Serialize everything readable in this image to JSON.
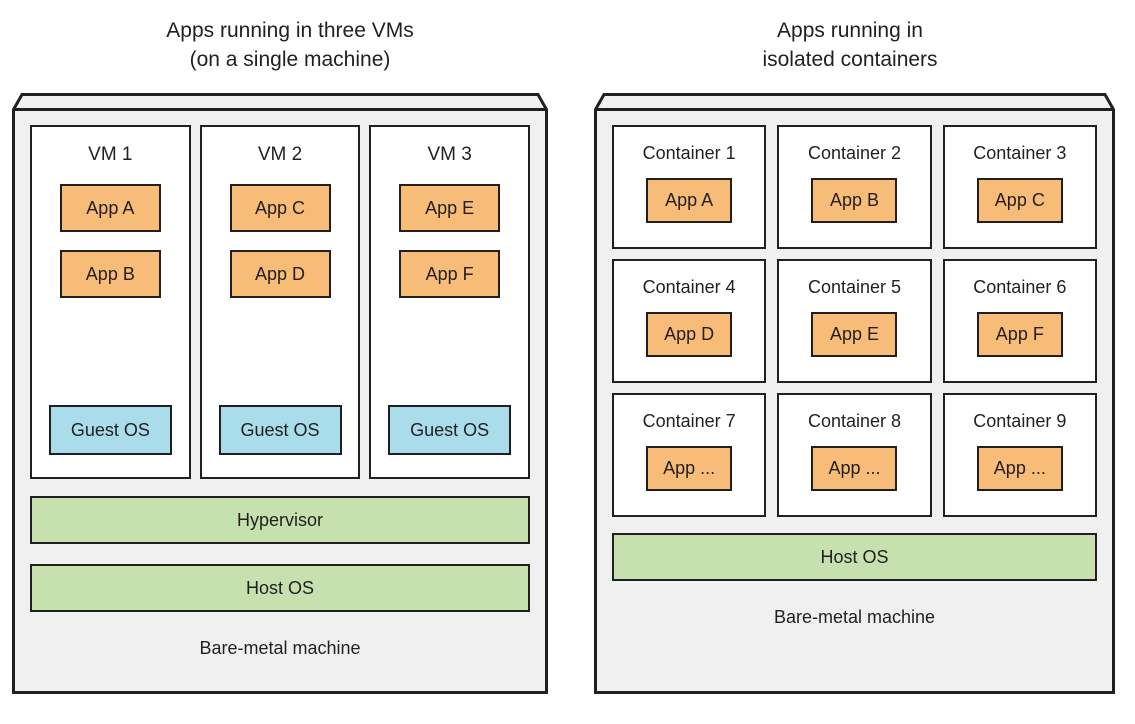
{
  "titles": {
    "left": "Apps running in three VMs\n(on a single machine)",
    "right": "Apps running in\nisolated containers"
  },
  "colors": {
    "app": "#f7bc77",
    "guest_os": "#a9ddec",
    "os_layer": "#c6e0ae",
    "machine_fill": "#f0f0f0",
    "stroke": "#231f20",
    "box_fill": "#ffffff"
  },
  "vm_panel": {
    "baremetal_label": "Bare-metal machine",
    "hypervisor_label": "Hypervisor",
    "host_os_label": "Host OS",
    "vms": [
      {
        "label": "VM 1",
        "apps": [
          "App A",
          "App B"
        ],
        "guest_os": "Guest OS"
      },
      {
        "label": "VM 2",
        "apps": [
          "App C",
          "App D"
        ],
        "guest_os": "Guest OS"
      },
      {
        "label": "VM 3",
        "apps": [
          "App E",
          "App F"
        ],
        "guest_os": "Guest OS"
      }
    ]
  },
  "container_panel": {
    "baremetal_label": "Bare-metal machine",
    "host_os_label": "Host OS",
    "containers": [
      {
        "label": "Container 1",
        "app": "App A"
      },
      {
        "label": "Container 2",
        "app": "App B"
      },
      {
        "label": "Container 3",
        "app": "App C"
      },
      {
        "label": "Container 4",
        "app": "App D"
      },
      {
        "label": "Container 5",
        "app": "App E"
      },
      {
        "label": "Container 6",
        "app": "App F"
      },
      {
        "label": "Container 7",
        "app": "App ..."
      },
      {
        "label": "Container 8",
        "app": "App ..."
      },
      {
        "label": "Container 9",
        "app": "App ..."
      }
    ]
  }
}
